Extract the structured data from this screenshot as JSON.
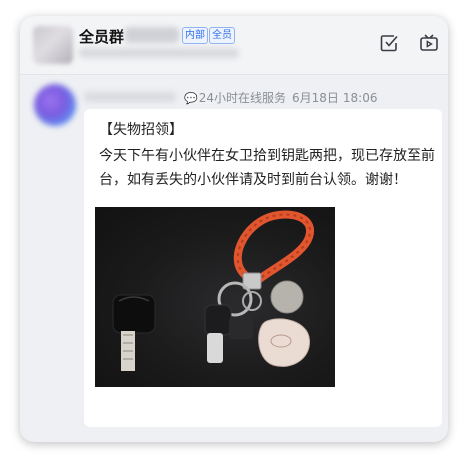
{
  "header": {
    "group_name": "全员群",
    "tags": [
      "内部",
      "全员"
    ],
    "icons": [
      "check-square-icon",
      "tv-icon"
    ]
  },
  "message": {
    "service_label": "24小时在线服务",
    "date": "6月18日",
    "time": "18:06",
    "title": "【失物招领】",
    "body": "今天下午有小伙伴在女卫拾到钥匙两把，现已存放至前台，如有丢失的小伙伴请及时到前台认领。谢谢！"
  },
  "colors": {
    "accent": "#2f6fe8",
    "keychain_strap": "#e2562f",
    "background": "#eef0f3"
  }
}
